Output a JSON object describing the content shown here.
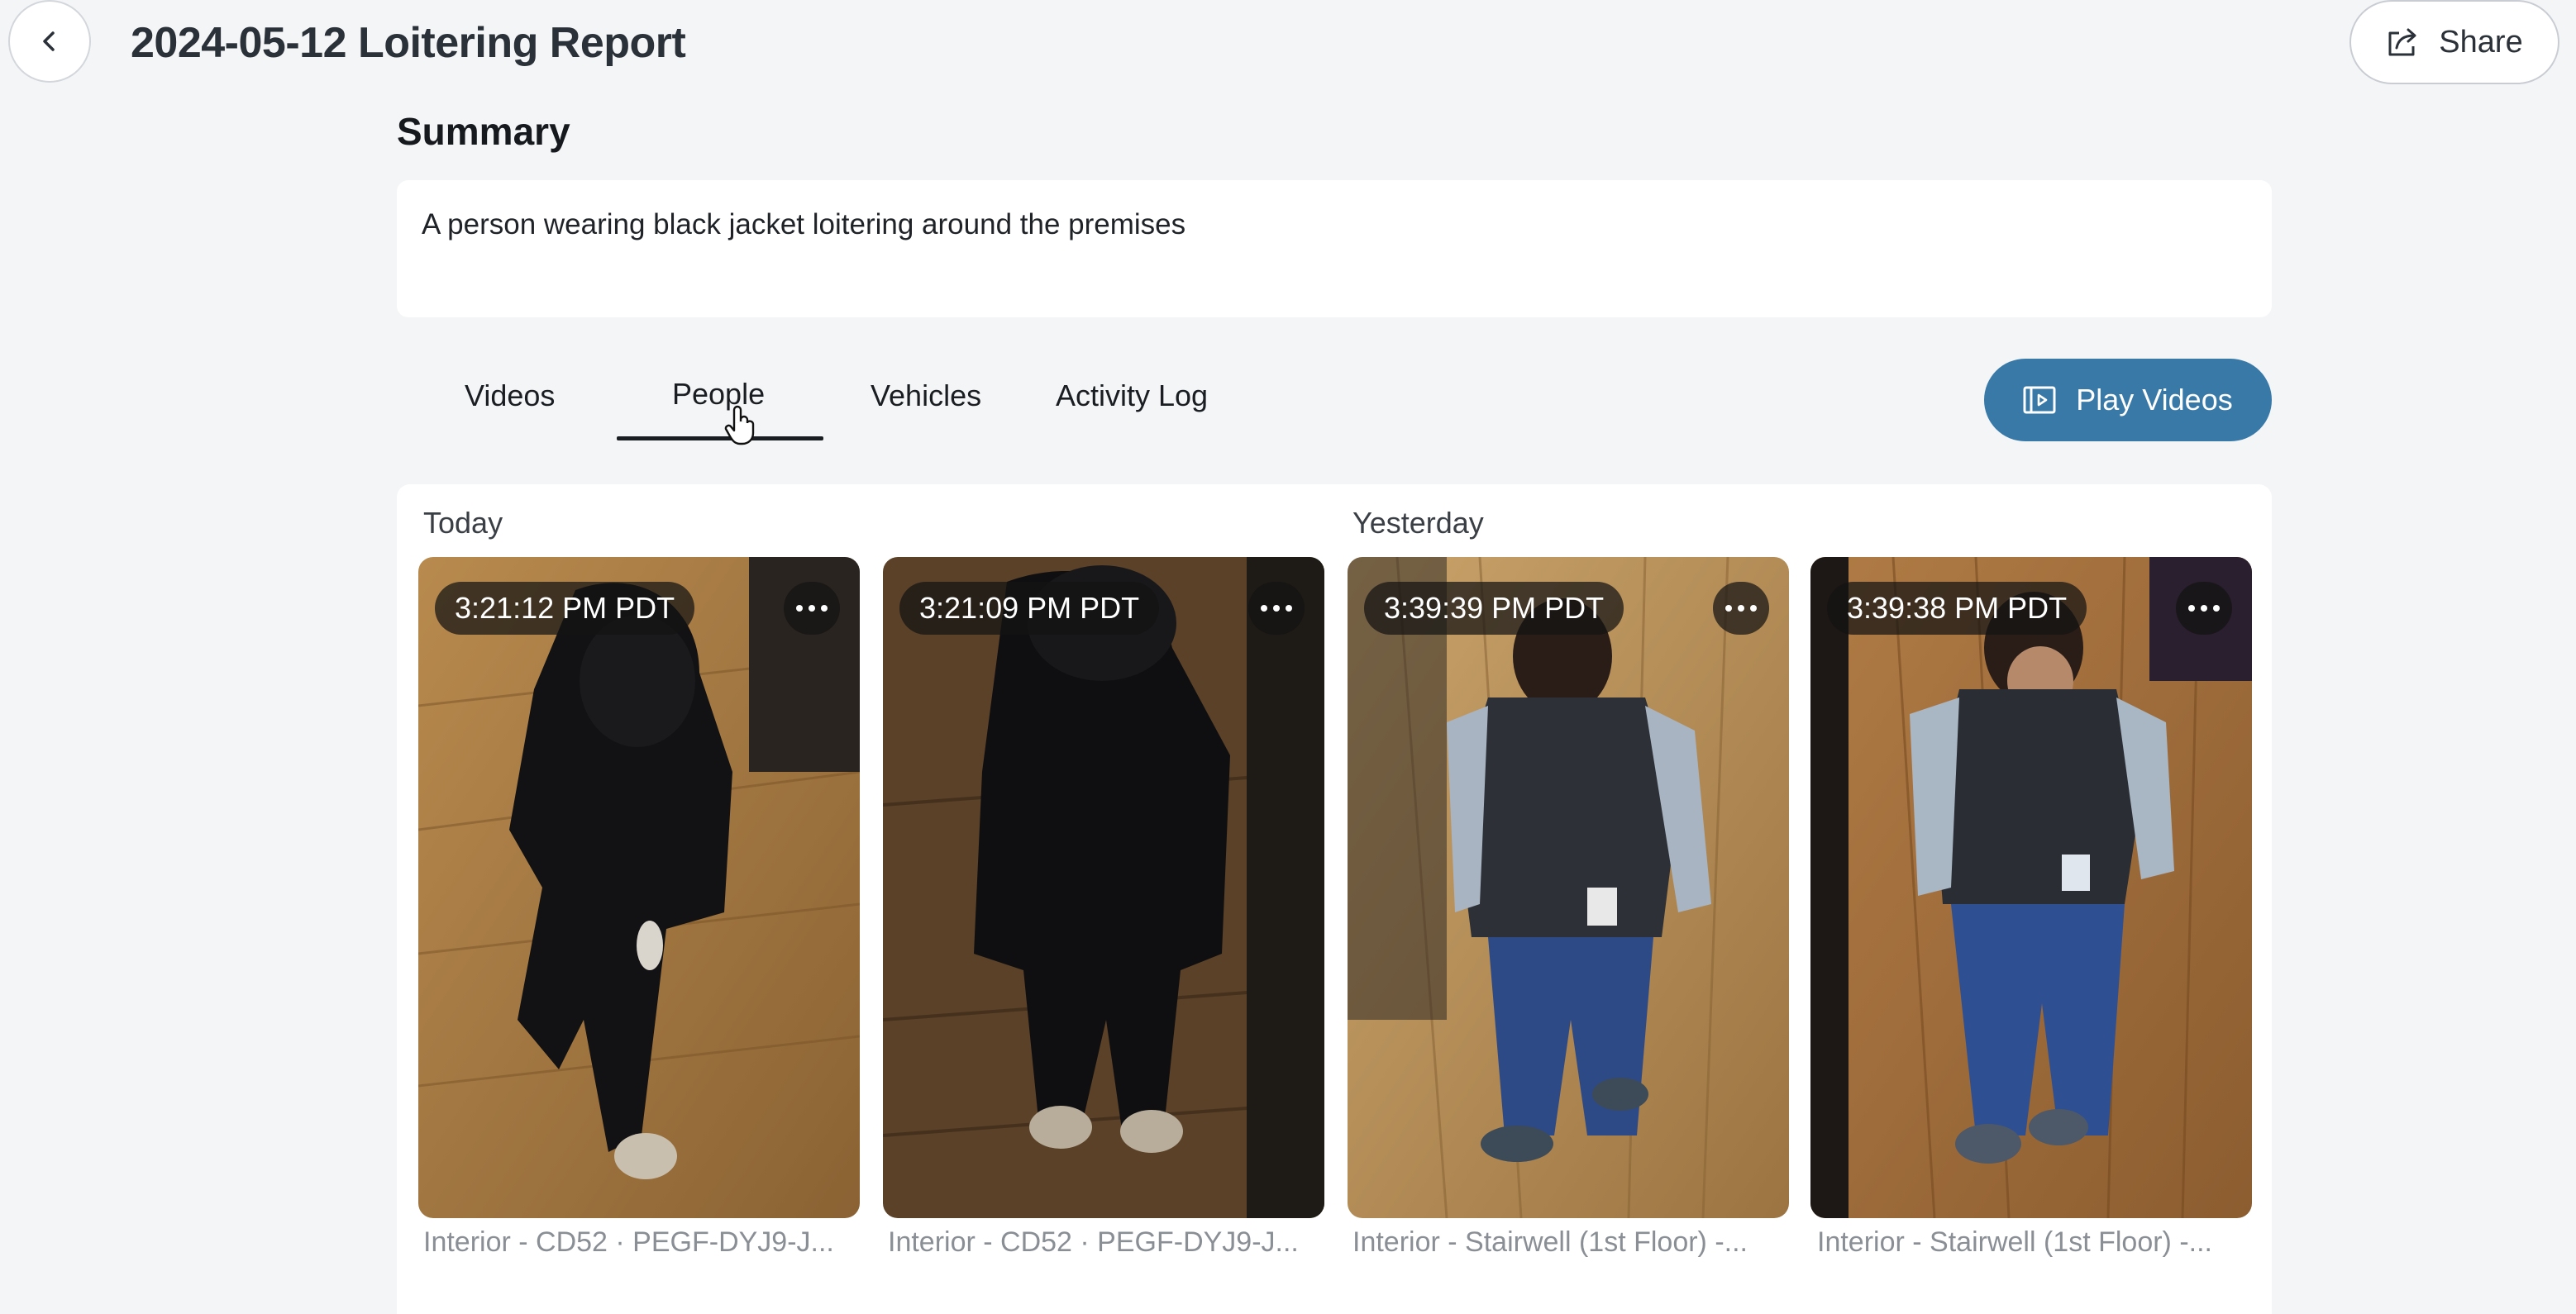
{
  "header": {
    "title": "2024-05-12 Loitering Report",
    "share_label": "Share"
  },
  "summary": {
    "heading": "Summary",
    "text": "A person wearing black jacket loitering around the premises"
  },
  "tabs": [
    {
      "label": "Videos",
      "active": false
    },
    {
      "label": "People",
      "active": true
    },
    {
      "label": "Vehicles",
      "active": false
    },
    {
      "label": "Activity Log",
      "active": false
    }
  ],
  "play_button": {
    "label": "Play Videos"
  },
  "groups": [
    {
      "label": "Today"
    },
    {
      "label": "Yesterday"
    }
  ],
  "cards": [
    {
      "time": "3:21:12 PM PDT",
      "caption": "Interior - CD52 · PEGF-DYJ9-J..."
    },
    {
      "time": "3:21:09 PM PDT",
      "caption": "Interior - CD52 · PEGF-DYJ9-J..."
    },
    {
      "time": "3:39:39 PM PDT",
      "caption": "Interior - Stairwell (1st Floor) -..."
    },
    {
      "time": "3:39:38 PM PDT",
      "caption": "Interior - Stairwell (1st Floor) -..."
    }
  ],
  "colors": {
    "accent": "#3879a8",
    "background": "#f4f5f7"
  }
}
